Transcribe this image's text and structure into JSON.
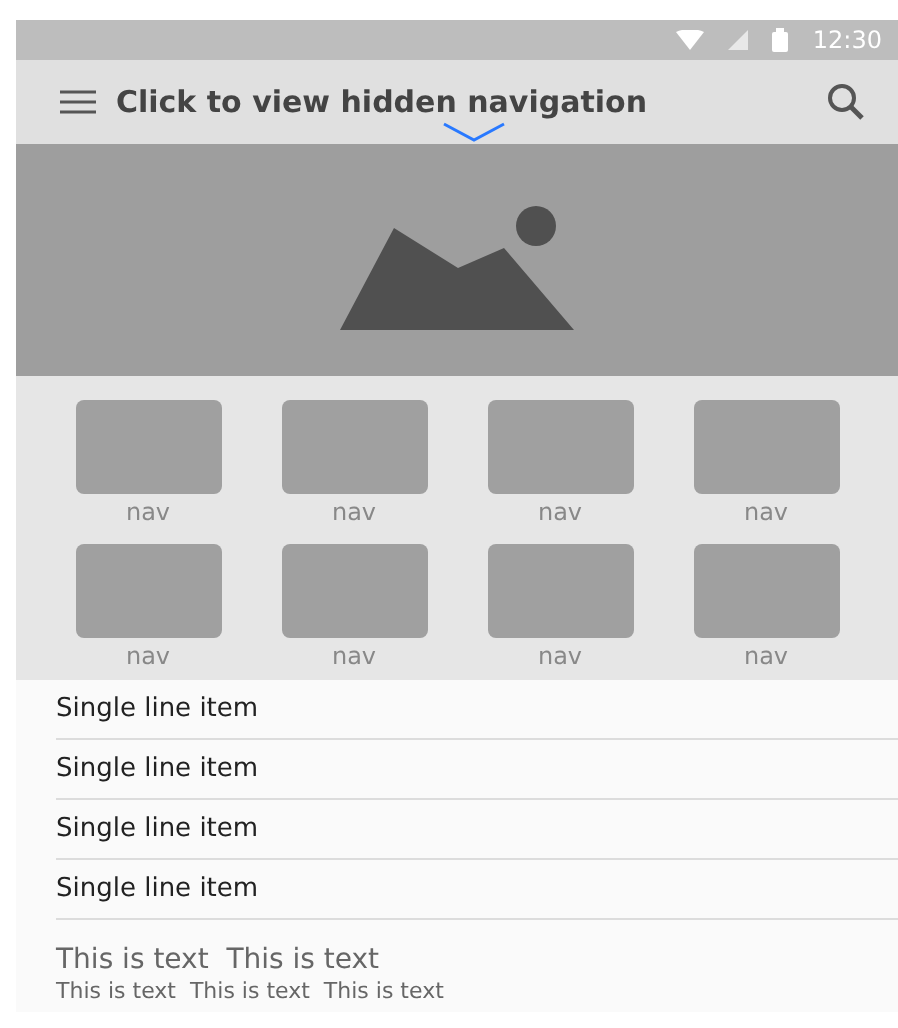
{
  "status_bar": {
    "time": "12:30"
  },
  "app_bar": {
    "title": "Click to view hidden navigation"
  },
  "nav_items": [
    {
      "label": "nav"
    },
    {
      "label": "nav"
    },
    {
      "label": "nav"
    },
    {
      "label": "nav"
    },
    {
      "label": "nav"
    },
    {
      "label": "nav"
    },
    {
      "label": "nav"
    },
    {
      "label": "nav"
    }
  ],
  "list_items": [
    "Single line item",
    "Single line item",
    "Single line item",
    "Single line item"
  ],
  "text_block": {
    "primary": "This is text  This is text",
    "secondary": "This is text  This is text  This is text"
  }
}
